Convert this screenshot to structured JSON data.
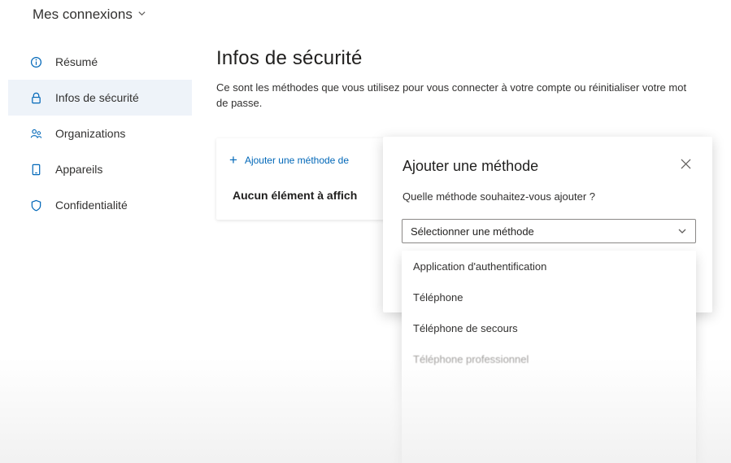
{
  "header": {
    "app_title": "Mes connexions"
  },
  "sidebar": {
    "items": [
      {
        "label": "Résumé",
        "icon": "info-icon"
      },
      {
        "label": "Infos de sécurité",
        "icon": "lock-icon",
        "active": true
      },
      {
        "label": "Organizations",
        "icon": "people-icon"
      },
      {
        "label": "Appareils",
        "icon": "device-icon"
      },
      {
        "label": "Confidentialité",
        "icon": "shield-icon"
      }
    ]
  },
  "main": {
    "title": "Infos de sécurité",
    "description": "Ce sont les méthodes que vous utilisez pour vous connecter à votre compte ou réinitialiser votre mot de passe.",
    "add_method_label": "Ajouter une méthode de",
    "empty_text": "Aucun élément à affich"
  },
  "dialog": {
    "title": "Ajouter une méthode",
    "question": "Quelle méthode souhaitez-vous ajouter ?",
    "select_value": "Sélectionner une méthode",
    "options": [
      "Application d'authentification",
      "Téléphone",
      "Téléphone de secours",
      "Téléphone professionnel"
    ]
  },
  "colors": {
    "accent": "#0067b8",
    "active_nav_bg": "#eef3f9",
    "text": "#201f1e"
  }
}
